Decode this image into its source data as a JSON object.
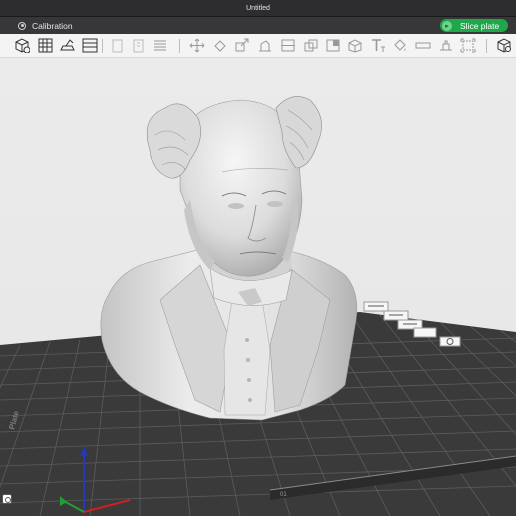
{
  "window": {
    "title": "Untitled"
  },
  "header": {
    "calibration_label": "Calibration",
    "slice_button_label": "Slice plate"
  },
  "toolbar": {
    "icons": [
      "add-object-icon",
      "grid-layout-icon",
      "import-icon",
      "plate-view-icon",
      "copy-icon",
      "paste-icon",
      "list-icon",
      "move-icon",
      "rotate-icon",
      "scale-icon",
      "lay-flat-icon",
      "cut-icon",
      "boolean-icon",
      "split-icon",
      "support-paint-icon",
      "text-icon",
      "fill-icon",
      "seam-icon",
      "measure-icon",
      "assemble-icon",
      "settings-cube-icon"
    ]
  },
  "plate": {
    "label_left": "Plate",
    "bottom_label": "01"
  },
  "colors": {
    "titlebar": "#2d2d30",
    "menubar": "#37373a",
    "accent": "#1fa84a",
    "bed": "#3a3a3a",
    "grid": "#5a5a5a",
    "model": "#dcdcdc"
  }
}
